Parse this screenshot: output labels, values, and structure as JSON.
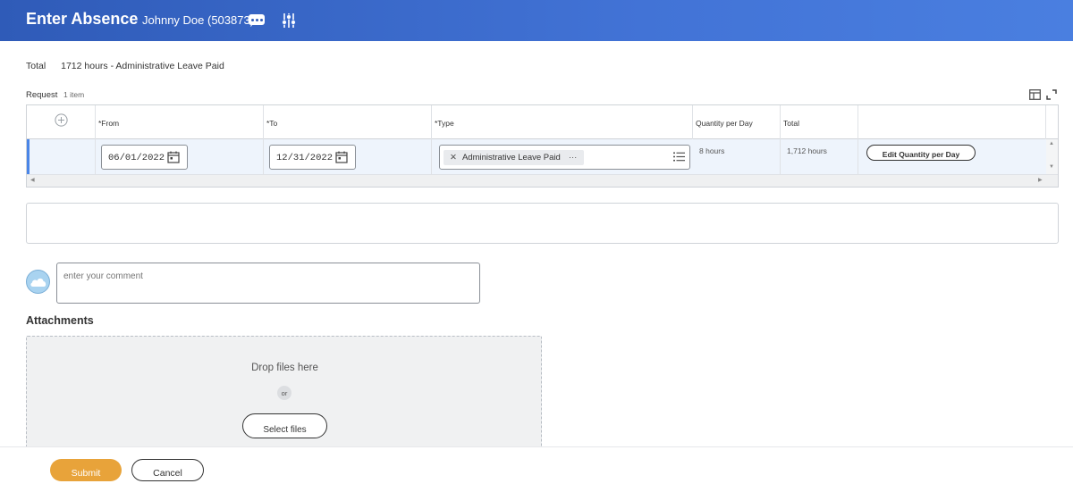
{
  "header": {
    "title": "Enter Absence",
    "worker": "Johnny Doe (503873)",
    "more_icon": "more-icon",
    "settings_icon": "settings-sliders-icon",
    "gradient_start": "#2f5bb8",
    "gradient_end": "#4a7fe0"
  },
  "total": {
    "label": "Total",
    "value": "1712 hours - Administrative Leave Paid"
  },
  "request": {
    "label": "Request",
    "count": "1 item",
    "columns": [
      "*From",
      "*To",
      "*Type",
      "Quantity per Day",
      "Total"
    ],
    "rows": [
      {
        "from": "06/01/2022",
        "to": "12/31/2022",
        "type": "Administrative Leave Paid",
        "quantity_per_day": "8 hours",
        "total": "1,712 hours",
        "action": "Edit Quantity per Day"
      }
    ]
  },
  "comment": {
    "placeholder": "enter your comment"
  },
  "attachments": {
    "title": "Attachments",
    "drop_text": "Drop files here",
    "or_text": "or",
    "select_label": "Select files"
  },
  "footer": {
    "submit": "Submit",
    "cancel": "Cancel",
    "submit_color": "#e8a33a"
  }
}
